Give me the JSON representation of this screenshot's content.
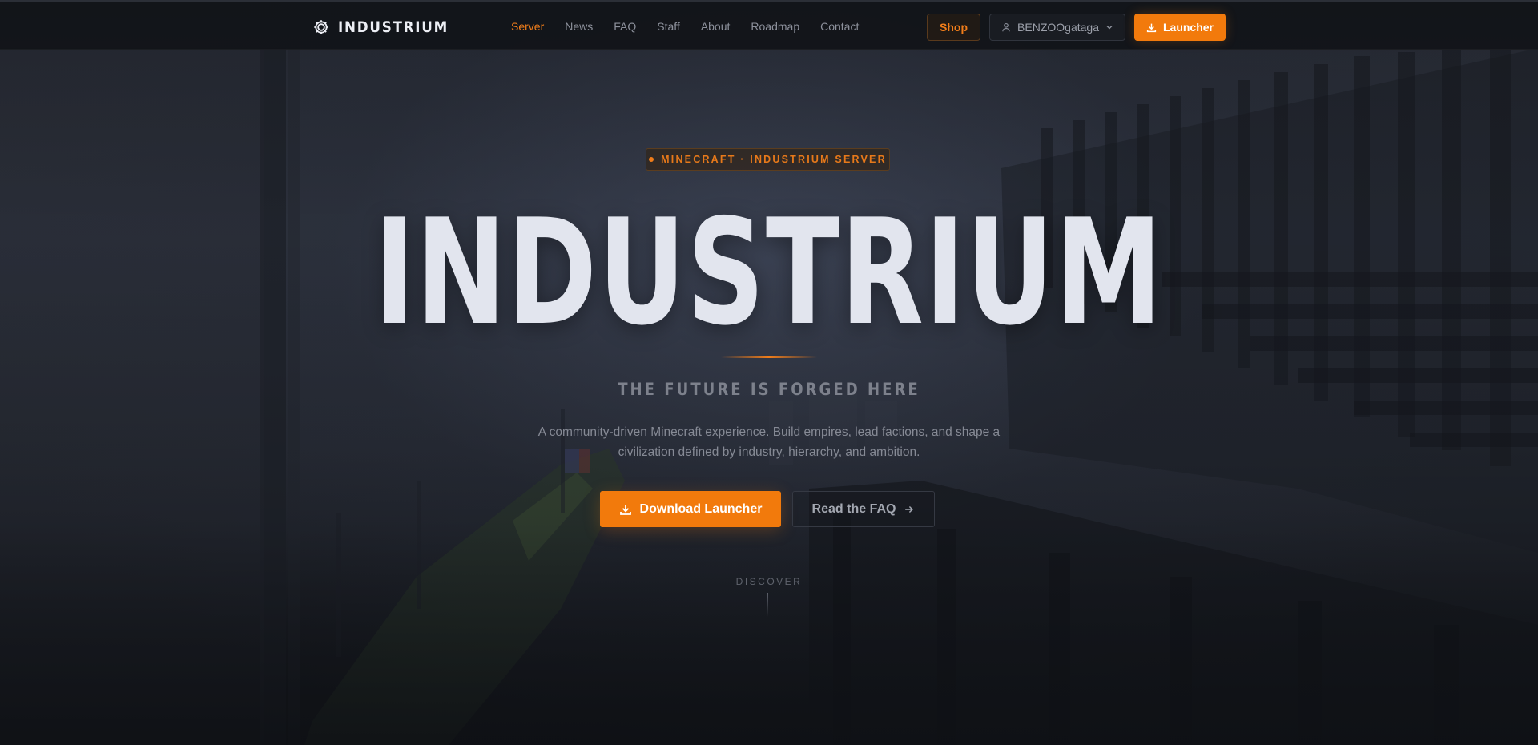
{
  "nav": {
    "brand": "INDUSTRIUM",
    "brand_icon": "gear-icon",
    "links": [
      {
        "label": "Server",
        "active": true
      },
      {
        "label": "News",
        "active": false
      },
      {
        "label": "FAQ",
        "active": false
      },
      {
        "label": "Staff",
        "active": false
      },
      {
        "label": "About",
        "active": false
      },
      {
        "label": "Roadmap",
        "active": false
      },
      {
        "label": "Contact",
        "active": false
      }
    ],
    "shop_label": "Shop",
    "user": {
      "name": "BENZOOgataga",
      "icon": "user-icon",
      "caret_icon": "chevron-down-icon"
    },
    "launcher_label": "Launcher",
    "launcher_icon": "download-icon"
  },
  "hero": {
    "badge": "MINECRAFT · INDUSTRIUM SERVER",
    "title": "INDUSTRIUM",
    "tagline": "THE FUTURE IS FORGED HERE",
    "description": "A community-driven Minecraft experience. Build empires, lead factions, and shape a civilization defined by industry, hierarchy, and ambition.",
    "primary_cta": "Download Launcher",
    "primary_cta_icon": "download-icon",
    "secondary_cta": "Read the FAQ",
    "secondary_cta_icon": "arrow-right-icon",
    "discover": "DISCOVER"
  },
  "colors": {
    "accent": "#f27a0c",
    "accent_text": "#f07d1a",
    "background": "#14171d",
    "title": "#e2e5ee",
    "muted": "#868a95"
  }
}
